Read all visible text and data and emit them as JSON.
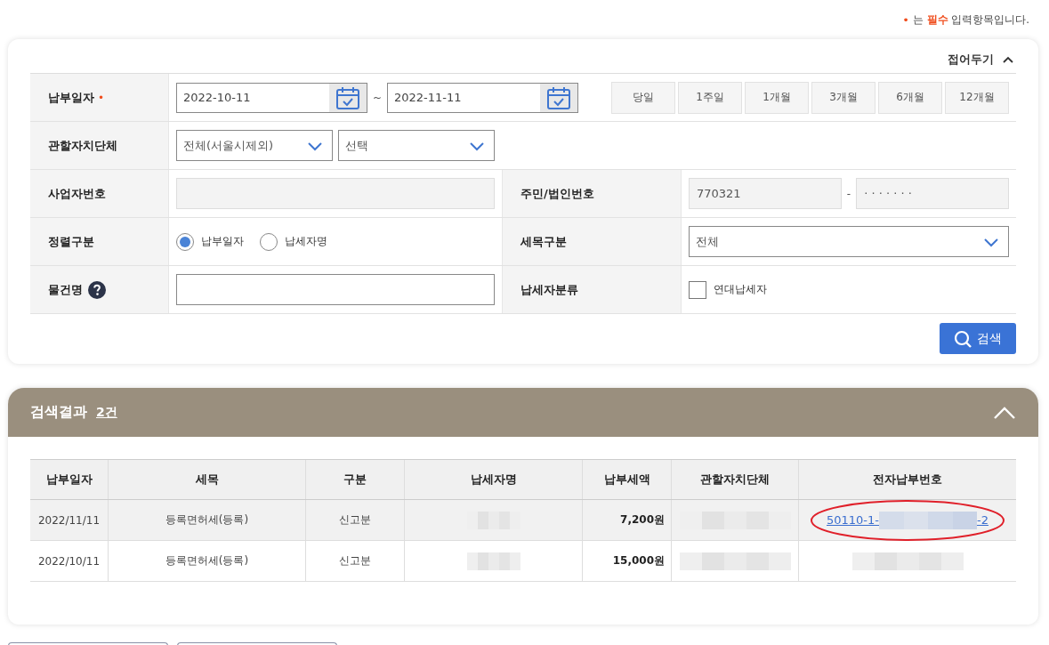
{
  "notice": {
    "mark": "•",
    "text": "는 **필수** 입력항목입니다."
  },
  "search_panel": {
    "toggle": {
      "label": "접어두기",
      "expanded": true
    },
    "rows": [
      {
        "cells": [
          {
            "label": "납부일자",
            "required": true,
            "controls": [
              {
                "kind": "date",
                "value": "2022-10-11"
              },
              {
                "kind": "separator",
                "text": "~"
              },
              {
                "kind": "date",
                "value": "2022-11-11"
              },
              {
                "kind": "period_buttons",
                "items": [
                  "당일",
                  "1주일",
                  "1개월",
                  "3개월",
                  "6개월",
                  "12개월"
                ]
              }
            ]
          }
        ]
      },
      {
        "cells": [
          {
            "label": "관할자치단체",
            "controls": [
              {
                "kind": "select",
                "value": "전체(서울시제외)"
              },
              {
                "kind": "select",
                "value": "선택"
              }
            ]
          }
        ]
      },
      {
        "cells": [
          {
            "label": "사업자번호",
            "controls": [
              {
                "kind": "input",
                "disabled": true
              }
            ]
          },
          {
            "label": "주민/법인번호",
            "controls": [
              {
                "kind": "input",
                "value": "770321",
                "disabled": true
              },
              {
                "kind": "separator",
                "text": "-"
              },
              {
                "kind": "input",
                "value": "· · · · · · ·",
                "disabled": true
              }
            ]
          }
        ]
      },
      {
        "cells": [
          {
            "label": "정렬구분",
            "controls": [
              {
                "kind": "radio_group",
                "options": [
                  {
                    "label": "납부일자",
                    "selected": true
                  },
                  {
                    "label": "납세자명",
                    "selected": false
                  }
                ]
              }
            ]
          },
          {
            "label": "세목구분",
            "controls": [
              {
                "kind": "select",
                "value": "전체"
              }
            ]
          }
        ]
      },
      {
        "cells": [
          {
            "label": "물건명",
            "help": true,
            "controls": [
              {
                "kind": "input",
                "disabled": false
              }
            ]
          },
          {
            "label": "납세자분류",
            "controls": [
              {
                "kind": "checkbox",
                "label": "연대납세자",
                "checked": false
              }
            ]
          }
        ]
      }
    ],
    "search_button": "검색"
  },
  "results": {
    "title": "검색결과",
    "count": "2건",
    "expanded": true,
    "columns": [
      "납부일자",
      "세목",
      "구분",
      "납세자명",
      "납부세액",
      "관할자치단체",
      "전자납부번호"
    ],
    "rows": [
      {
        "selected": true,
        "cells": [
          {
            "kind": "text",
            "text": "2022/11/11"
          },
          {
            "kind": "text",
            "text": "등록면허세(등록)"
          },
          {
            "kind": "text",
            "text": "신고분"
          },
          {
            "kind": "redacted"
          },
          {
            "kind": "amount",
            "text": "7,200원"
          },
          {
            "kind": "redacted"
          },
          {
            "kind": "link",
            "parts": [
              "50110-1-",
              "-2"
            ],
            "circled": true
          }
        ]
      },
      {
        "selected": false,
        "cells": [
          {
            "kind": "text",
            "text": "2022/10/11"
          },
          {
            "kind": "text",
            "text": "등록면허세(등록)"
          },
          {
            "kind": "text",
            "text": "신고분"
          },
          {
            "kind": "redacted"
          },
          {
            "kind": "amount",
            "text": "15,000원"
          },
          {
            "kind": "redacted"
          },
          {
            "kind": "redacted"
          }
        ]
      }
    ]
  },
  "bottom_buttons": [
    {
      "kind": "outline"
    },
    {
      "kind": "outline"
    }
  ]
}
